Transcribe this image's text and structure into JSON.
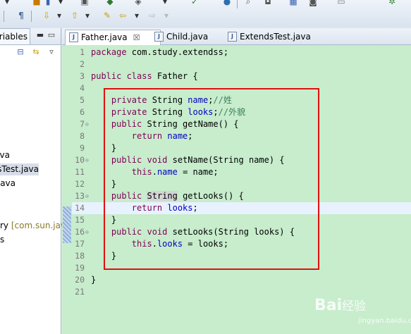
{
  "toolbar": {
    "row1": [
      "chevron-icon",
      "package-icon",
      "book-icon",
      "dropdown-arrow-icon",
      "image-icon",
      "run-icon",
      "debug-icon",
      "dropdown-arrow-icon",
      "check-icon",
      "globe-icon",
      "search-icon",
      "nav-icon",
      "calendar-icon",
      "build-icon",
      "settings-icon",
      "gear-icon"
    ],
    "row2": [
      "pilcrow-icon",
      "next-annotation-icon",
      "prev-annotation-icon",
      "last-edit-icon",
      "back-icon",
      "forward-icon"
    ]
  },
  "left_panel": {
    "tab_label": "ariables",
    "items": [
      {
        "text": "va",
        "selected": false
      },
      {
        "text": "sTest.java",
        "selected": true
      },
      {
        "text": "ava",
        "selected": false
      },
      {
        "text": "ry ",
        "pkg": "[com.sun.jav",
        "selected": false
      },
      {
        "text": "s",
        "selected": false
      }
    ]
  },
  "editor": {
    "tabs": [
      {
        "label": "Father.java",
        "active": true,
        "close": "☒"
      },
      {
        "label": "Child.java",
        "active": false
      },
      {
        "label": "ExtendsTest.java",
        "active": false
      }
    ],
    "lines": [
      {
        "num": "1",
        "tokens": [
          {
            "t": "package com.study.extendss;",
            "c": "kw-pkg"
          }
        ]
      },
      {
        "num": "2",
        "tokens": []
      },
      {
        "num": "3",
        "tokens": [
          {
            "t": "public class ",
            "c": "kw"
          },
          {
            "t": "Father {",
            "c": ""
          }
        ]
      },
      {
        "num": "4",
        "tokens": []
      },
      {
        "num": "5",
        "tokens": [
          {
            "t": "    private ",
            "c": "kw"
          },
          {
            "t": "String ",
            "c": ""
          },
          {
            "t": "name",
            "c": "fld"
          },
          {
            "t": ";",
            "c": ""
          },
          {
            "t": "//姓",
            "c": "cmt"
          }
        ]
      },
      {
        "num": "6",
        "tokens": [
          {
            "t": "    private ",
            "c": "kw"
          },
          {
            "t": "String ",
            "c": ""
          },
          {
            "t": "looks",
            "c": "fld"
          },
          {
            "t": ";",
            "c": ""
          },
          {
            "t": "//外貌",
            "c": "cmt"
          }
        ]
      },
      {
        "num": "7",
        "fold": true,
        "tokens": [
          {
            "t": "    public ",
            "c": "kw"
          },
          {
            "t": "String getName() {",
            "c": ""
          }
        ]
      },
      {
        "num": "8",
        "tokens": [
          {
            "t": "        return ",
            "c": "kw"
          },
          {
            "t": "name",
            "c": "fld"
          },
          {
            "t": ";",
            "c": ""
          }
        ]
      },
      {
        "num": "9",
        "tokens": [
          {
            "t": "    }",
            "c": ""
          }
        ]
      },
      {
        "num": "10",
        "fold": true,
        "tokens": [
          {
            "t": "    public void ",
            "c": "kw"
          },
          {
            "t": "setName(String name) {",
            "c": ""
          }
        ]
      },
      {
        "num": "11",
        "tokens": [
          {
            "t": "        this",
            "c": "kw"
          },
          {
            "t": ".",
            "c": ""
          },
          {
            "t": "name",
            "c": "fld"
          },
          {
            "t": " = name;",
            "c": ""
          }
        ]
      },
      {
        "num": "12",
        "tokens": [
          {
            "t": "    }",
            "c": ""
          }
        ]
      },
      {
        "num": "13",
        "fold": true,
        "tokens": [
          {
            "t": "    public ",
            "c": "kw"
          },
          {
            "t": "String",
            "c": "occ"
          },
          {
            "t": " getLooks() {",
            "c": ""
          }
        ]
      },
      {
        "num": "14",
        "hl": true,
        "tokens": [
          {
            "t": "        return ",
            "c": "kw"
          },
          {
            "t": "looks",
            "c": "fld"
          },
          {
            "t": ";",
            "c": ""
          }
        ]
      },
      {
        "num": "15",
        "tokens": [
          {
            "t": "    }",
            "c": ""
          }
        ]
      },
      {
        "num": "16",
        "fold": true,
        "tokens": [
          {
            "t": "    public void ",
            "c": "kw"
          },
          {
            "t": "setLooks(String looks) {",
            "c": ""
          }
        ]
      },
      {
        "num": "17",
        "tokens": [
          {
            "t": "        this",
            "c": "kw"
          },
          {
            "t": ".",
            "c": ""
          },
          {
            "t": "looks",
            "c": "fld"
          },
          {
            "t": " = looks;",
            "c": ""
          }
        ]
      },
      {
        "num": "18",
        "tokens": [
          {
            "t": "    }",
            "c": ""
          }
        ]
      },
      {
        "num": "19",
        "tokens": []
      },
      {
        "num": "20",
        "tokens": [
          {
            "t": "}",
            "c": ""
          }
        ]
      },
      {
        "num": "21",
        "tokens": []
      }
    ]
  },
  "watermark": {
    "brand": "Bai",
    "brand2": "经验",
    "sub": "jingyan.baidu.com"
  },
  "colors": {
    "editor_bg": "#c7edcc",
    "keyword": "#7f0055",
    "field": "#0000c0",
    "comment": "#3f7f5f",
    "highlight_box": "#e01010",
    "current_line": "#e8f2fe"
  }
}
